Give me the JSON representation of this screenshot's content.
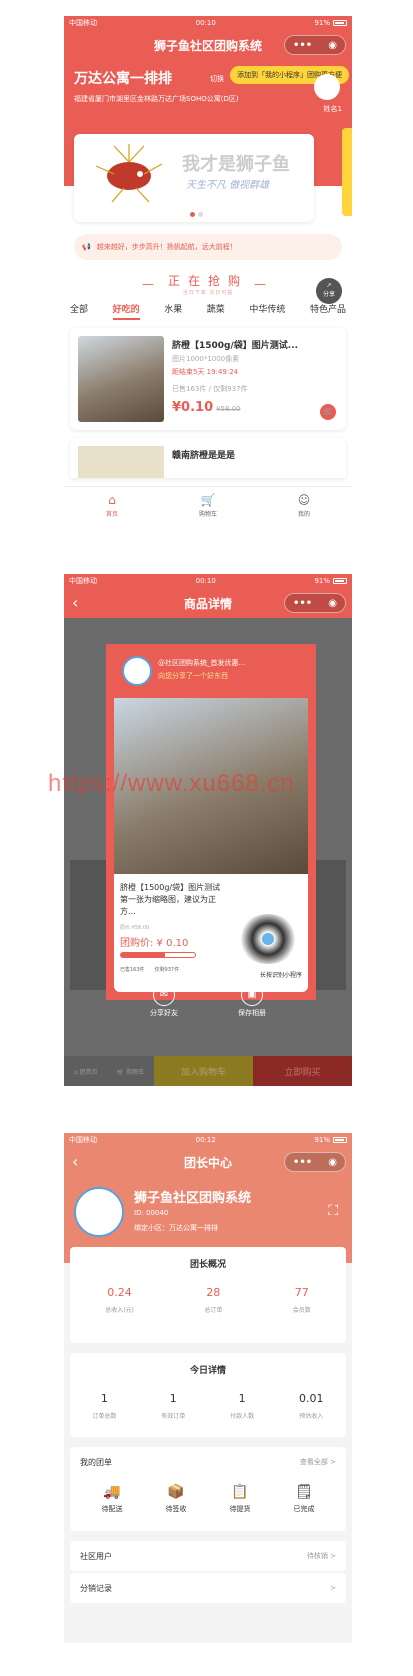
{
  "status": {
    "carrier": "中国移动",
    "time1": "00:10",
    "time2": "00:10",
    "time3": "00:12",
    "battery": "91%"
  },
  "capsule": {
    "more": "•••",
    "close": "◉"
  },
  "home": {
    "title": "狮子鱼社区团购系统",
    "tip": "添加到「我的小程序」团购更方便",
    "community": "万达公寓一排排",
    "switch": "切换",
    "address": "福建省厦门市湖里区金林路万达广场SOHO公寓(D区)",
    "leader_name": "姓名1",
    "banner_text1": "我才是狮子鱼",
    "banner_text2": "天生不凡  傲视群雄",
    "notice": "越来越好，步步高升！扬帆起航，远大前程！",
    "section_title": "正在抢购",
    "section_sub": "当日下单  次日可提",
    "share": "分享",
    "tabs": [
      "全部",
      "好吃的",
      "水果",
      "蔬菜",
      "中华传统",
      "特色产品"
    ],
    "product": {
      "title": "脐橙【1500g/袋】图片测试...",
      "spec": "图片1000*1000像素",
      "ends": "距结束5天 19:49:24",
      "sold": "已售163件 / 仅剩937件",
      "price": "¥0.10",
      "orig": "¥58.00"
    },
    "product2_title": "赣南脐橙是是是",
    "tabbar": [
      "首页",
      "购物车",
      "我的"
    ]
  },
  "detail": {
    "title": "商品详情",
    "poster_name": "@社区团购系统_首发优惠...",
    "poster_sub": "向您分享了一个好东西",
    "poster_title": "脐橙【1500g/袋】图片测试第一张为缩略图，建议为正方...",
    "poster_orig": "原价:¥58.00",
    "poster_price": "团购价: ¥ 0.10",
    "poster_sold": "已售163件",
    "poster_left": "仅剩937件",
    "qr_tip": "长按识别小程序",
    "share_friend": "分享好友",
    "save_album": "保存相册",
    "home_btn": "团首页",
    "cart_btn": "购物车",
    "add_cart": "加入购物车",
    "buy_now": "立即购买",
    "watermark": "https://www.xu668.cn"
  },
  "leader": {
    "title": "团长中心",
    "name": "狮子鱼社区团购系统",
    "id": "ID: 00040",
    "bind": "绑定小区：万达公寓一排排",
    "overview_title": "团长概况",
    "overview": [
      {
        "v": "0.24",
        "l": "总收入(元)"
      },
      {
        "v": "28",
        "l": "总订单"
      },
      {
        "v": "77",
        "l": "会员数"
      }
    ],
    "today_title": "今日详情",
    "today": [
      {
        "v": "1",
        "l": "订单总数"
      },
      {
        "v": "1",
        "l": "有效订单"
      },
      {
        "v": "1",
        "l": "付款人数"
      },
      {
        "v": "0.01",
        "l": "预估收入"
      }
    ],
    "my_group": "我的团单",
    "view_all": "查看全部 >",
    "group_icons": [
      "待配送",
      "待签收",
      "待提货",
      "已完成"
    ],
    "users": "社区用户",
    "users_tag": "待核销 >",
    "dist": "分销记录",
    "dist_arrow": ">"
  }
}
